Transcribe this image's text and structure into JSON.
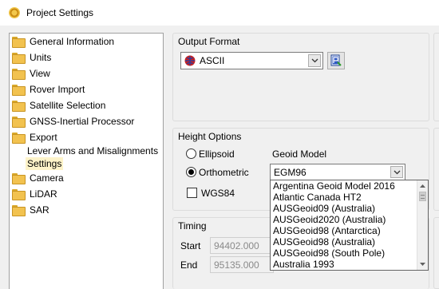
{
  "window": {
    "title": "Project Settings",
    "icon": "gear-icon"
  },
  "tree": {
    "items": [
      {
        "label": "General Information"
      },
      {
        "label": "Units"
      },
      {
        "label": "View"
      },
      {
        "label": "Rover Import"
      },
      {
        "label": "Satellite Selection"
      },
      {
        "label": "GNSS-Inertial Processor"
      },
      {
        "label": "Export"
      },
      {
        "label": "Lever Arms and Misalignments"
      },
      {
        "label": "Settings",
        "selected": true
      },
      {
        "label": "Camera"
      },
      {
        "label": "LiDAR"
      },
      {
        "label": "SAR"
      }
    ]
  },
  "output_format": {
    "title": "Output Format",
    "value": "ASCII"
  },
  "height_options": {
    "title": "Height Options",
    "ellipsoid_label": "Ellipsoid",
    "orthometric_label": "Orthometric",
    "selected": "Orthometric",
    "wgs84_label": "WGS84",
    "wgs84_checked": false,
    "geoid_label": "Geoid Model",
    "geoid_value": "EGM96",
    "geoid_options": [
      "Argentina Geoid Model 2016",
      "Atlantic Canada HT2",
      "AUSGeoid09 (Australia)",
      "AUSGeoid2020 (Australia)",
      "AUSGeoid98 (Antarctica)",
      "AUSGeoid98 (Australia)",
      "AUSGeoid98 (South Pole)",
      "Australia 1993"
    ]
  },
  "timing": {
    "title": "Timing",
    "start_label": "Start",
    "start_value": "94402.000",
    "end_label": "End",
    "end_value": "95135.000"
  }
}
